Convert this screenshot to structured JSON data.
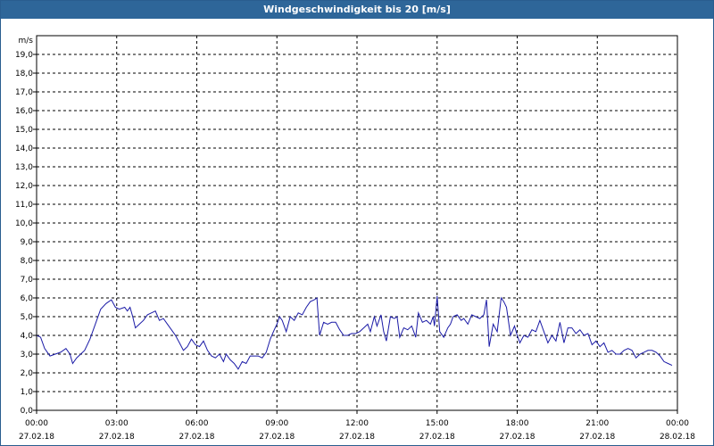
{
  "window": {
    "title": "Windgeschwindigkeit bis 20 [m/s]"
  },
  "colors": {
    "title_bar": "#2e6699",
    "series": "#1a1aa6",
    "grid": "#000000"
  },
  "chart_data": {
    "type": "line",
    "title": "Windgeschwindigkeit bis 20 [m/s]",
    "ylabel": "m/s",
    "xlabel": "",
    "ylim": [
      0,
      20
    ],
    "xlim_hours": [
      0,
      24
    ],
    "grid": true,
    "y_ticks": [
      "0,0",
      "1,0",
      "2,0",
      "3,0",
      "4,0",
      "5,0",
      "6,0",
      "7,0",
      "8,0",
      "9,0",
      "10,0",
      "11,0",
      "12,0",
      "13,0",
      "14,0",
      "15,0",
      "16,0",
      "17,0",
      "18,0",
      "19,0"
    ],
    "x_ticks": [
      {
        "time": "00:00",
        "date": "27.02.18"
      },
      {
        "time": "03:00",
        "date": "27.02.18"
      },
      {
        "time": "06:00",
        "date": "27.02.18"
      },
      {
        "time": "09:00",
        "date": "27.02.18"
      },
      {
        "time": "12:00",
        "date": "27.02.18"
      },
      {
        "time": "15:00",
        "date": "27.02.18"
      },
      {
        "time": "18:00",
        "date": "27.02.18"
      },
      {
        "time": "21:00",
        "date": "27.02.18"
      },
      {
        "time": "00:00",
        "date": "28.02.18"
      }
    ],
    "series": [
      {
        "points": [
          [
            0.0,
            4.0
          ],
          [
            0.15,
            3.9
          ],
          [
            0.3,
            3.3
          ],
          [
            0.5,
            2.9
          ],
          [
            0.7,
            3.0
          ],
          [
            0.9,
            3.1
          ],
          [
            1.1,
            3.3
          ],
          [
            1.25,
            3.0
          ],
          [
            1.35,
            2.5
          ],
          [
            1.5,
            2.8
          ],
          [
            1.65,
            3.0
          ],
          [
            1.8,
            3.2
          ],
          [
            2.0,
            3.8
          ],
          [
            2.2,
            4.6
          ],
          [
            2.4,
            5.4
          ],
          [
            2.6,
            5.7
          ],
          [
            2.8,
            5.9
          ],
          [
            2.95,
            5.5
          ],
          [
            3.1,
            5.4
          ],
          [
            3.3,
            5.5
          ],
          [
            3.4,
            5.3
          ],
          [
            3.5,
            5.5
          ],
          [
            3.6,
            5.0
          ],
          [
            3.7,
            4.4
          ],
          [
            3.85,
            4.6
          ],
          [
            4.0,
            4.8
          ],
          [
            4.15,
            5.1
          ],
          [
            4.3,
            5.2
          ],
          [
            4.45,
            5.3
          ],
          [
            4.6,
            4.8
          ],
          [
            4.75,
            4.9
          ],
          [
            4.9,
            4.6
          ],
          [
            5.05,
            4.3
          ],
          [
            5.2,
            4.0
          ],
          [
            5.35,
            3.6
          ],
          [
            5.5,
            3.2
          ],
          [
            5.65,
            3.4
          ],
          [
            5.8,
            3.8
          ],
          [
            5.95,
            3.5
          ],
          [
            6.1,
            3.4
          ],
          [
            6.25,
            3.7
          ],
          [
            6.4,
            3.2
          ],
          [
            6.55,
            2.9
          ],
          [
            6.7,
            2.8
          ],
          [
            6.85,
            3.0
          ],
          [
            7.0,
            2.6
          ],
          [
            7.1,
            3.0
          ],
          [
            7.25,
            2.7
          ],
          [
            7.4,
            2.5
          ],
          [
            7.55,
            2.2
          ],
          [
            7.7,
            2.6
          ],
          [
            7.85,
            2.5
          ],
          [
            8.0,
            2.9
          ],
          [
            8.15,
            2.9
          ],
          [
            8.3,
            2.9
          ],
          [
            8.45,
            2.8
          ],
          [
            8.6,
            3.1
          ],
          [
            8.75,
            3.8
          ],
          [
            8.9,
            4.3
          ],
          [
            9.0,
            4.6
          ],
          [
            9.1,
            5.0
          ],
          [
            9.2,
            4.8
          ],
          [
            9.35,
            4.2
          ],
          [
            9.5,
            5.0
          ],
          [
            9.65,
            4.8
          ],
          [
            9.8,
            5.2
          ],
          [
            9.95,
            5.1
          ],
          [
            10.1,
            5.5
          ],
          [
            10.25,
            5.8
          ],
          [
            10.4,
            5.9
          ],
          [
            10.5,
            6.0
          ],
          [
            10.6,
            4.0
          ],
          [
            10.75,
            4.7
          ],
          [
            10.9,
            4.6
          ],
          [
            11.05,
            4.7
          ],
          [
            11.2,
            4.7
          ],
          [
            11.35,
            4.3
          ],
          [
            11.5,
            4.0
          ],
          [
            11.65,
            4.0
          ],
          [
            11.8,
            4.1
          ],
          [
            11.95,
            4.1
          ],
          [
            12.1,
            4.2
          ],
          [
            12.25,
            4.4
          ],
          [
            12.4,
            4.6
          ],
          [
            12.5,
            4.2
          ],
          [
            12.65,
            5.0
          ],
          [
            12.75,
            4.5
          ],
          [
            12.9,
            5.1
          ],
          [
            13.0,
            4.2
          ],
          [
            13.1,
            3.7
          ],
          [
            13.25,
            5.0
          ],
          [
            13.4,
            4.9
          ],
          [
            13.5,
            5.0
          ],
          [
            13.6,
            3.9
          ],
          [
            13.75,
            4.4
          ],
          [
            13.9,
            4.3
          ],
          [
            14.05,
            4.5
          ],
          [
            14.2,
            3.9
          ],
          [
            14.3,
            5.2
          ],
          [
            14.45,
            4.7
          ],
          [
            14.6,
            4.8
          ],
          [
            14.75,
            4.6
          ],
          [
            14.85,
            5.0
          ],
          [
            14.9,
            4.5
          ],
          [
            15.0,
            6.1
          ],
          [
            15.1,
            4.2
          ],
          [
            15.25,
            3.9
          ],
          [
            15.4,
            4.4
          ],
          [
            15.5,
            4.6
          ],
          [
            15.6,
            5.0
          ],
          [
            15.75,
            5.1
          ],
          [
            15.9,
            4.8
          ],
          [
            16.0,
            4.9
          ],
          [
            16.15,
            4.6
          ],
          [
            16.3,
            5.1
          ],
          [
            16.45,
            5.0
          ],
          [
            16.6,
            4.9
          ],
          [
            16.75,
            5.1
          ],
          [
            16.85,
            5.9
          ],
          [
            16.95,
            3.4
          ],
          [
            17.1,
            4.6
          ],
          [
            17.25,
            4.2
          ],
          [
            17.4,
            6.0
          ],
          [
            17.5,
            5.8
          ],
          [
            17.6,
            5.5
          ],
          [
            17.75,
            4.0
          ],
          [
            17.9,
            4.5
          ],
          [
            18.0,
            4.0
          ],
          [
            18.1,
            3.6
          ],
          [
            18.25,
            4.0
          ],
          [
            18.4,
            3.9
          ],
          [
            18.55,
            4.3
          ],
          [
            18.7,
            4.2
          ],
          [
            18.85,
            4.8
          ],
          [
            19.0,
            4.2
          ],
          [
            19.15,
            3.6
          ],
          [
            19.3,
            4.0
          ],
          [
            19.45,
            3.7
          ],
          [
            19.6,
            4.7
          ],
          [
            19.75,
            3.6
          ],
          [
            19.9,
            4.4
          ],
          [
            20.05,
            4.4
          ],
          [
            20.2,
            4.1
          ],
          [
            20.35,
            4.3
          ],
          [
            20.5,
            4.0
          ],
          [
            20.65,
            4.1
          ],
          [
            20.8,
            3.5
          ],
          [
            20.95,
            3.7
          ],
          [
            21.1,
            3.4
          ],
          [
            21.25,
            3.6
          ],
          [
            21.4,
            3.1
          ],
          [
            21.55,
            3.2
          ],
          [
            21.7,
            3.0
          ],
          [
            21.85,
            3.0
          ],
          [
            22.0,
            3.2
          ],
          [
            22.15,
            3.3
          ],
          [
            22.3,
            3.2
          ],
          [
            22.45,
            2.8
          ],
          [
            22.6,
            3.0
          ],
          [
            22.75,
            3.1
          ],
          [
            22.9,
            3.2
          ],
          [
            23.05,
            3.2
          ],
          [
            23.2,
            3.1
          ],
          [
            23.35,
            2.9
          ],
          [
            23.5,
            2.6
          ],
          [
            23.65,
            2.5
          ],
          [
            23.8,
            2.4
          ]
        ]
      }
    ]
  }
}
